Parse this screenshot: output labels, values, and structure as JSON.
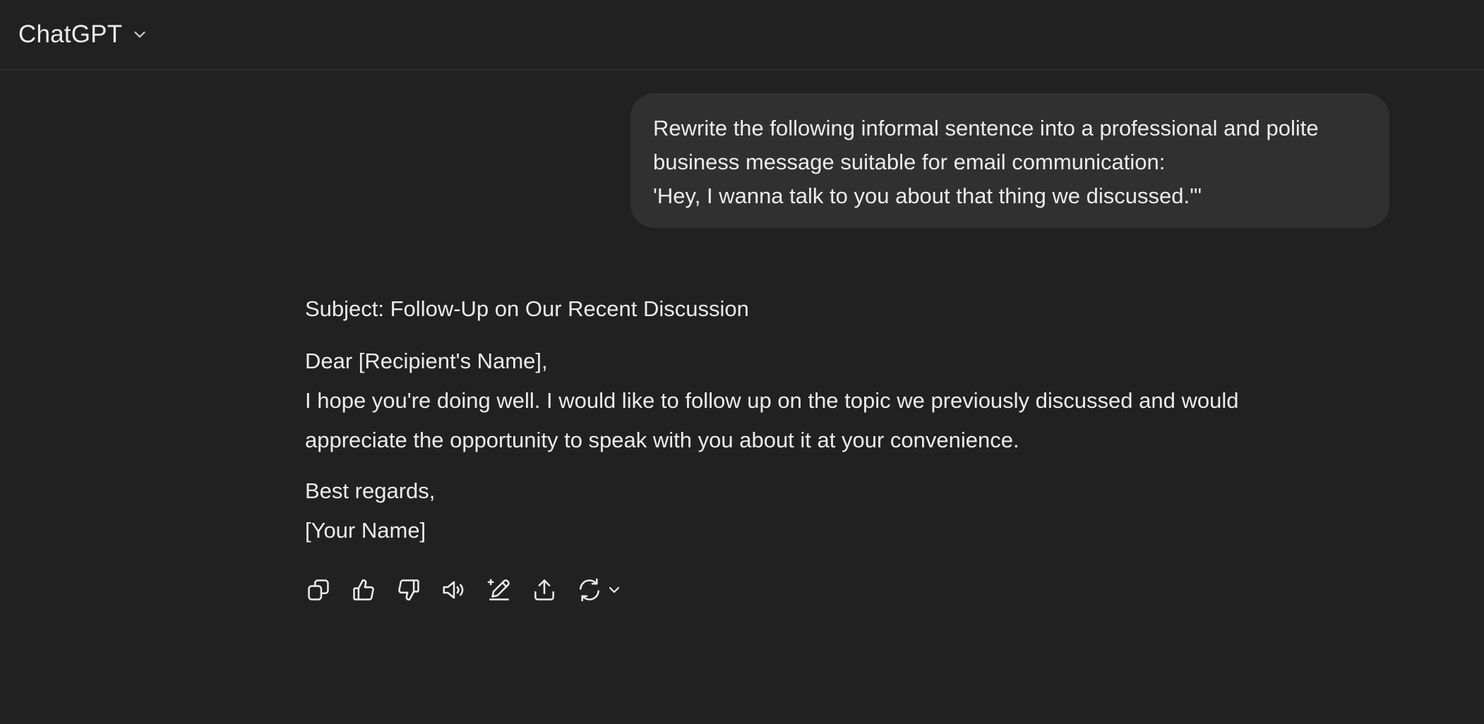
{
  "header": {
    "model_name": "ChatGPT",
    "model_switch_icon": "chevron-down-icon"
  },
  "user_message": {
    "lines": [
      "Rewrite the following informal sentence into a professional and polite",
      "business message suitable for email communication:",
      "'Hey, I wanna talk to you about that thing we discussed.'\""
    ]
  },
  "assistant_message": {
    "subject": "Subject: Follow-Up on Our Recent Discussion",
    "greeting": "Dear [Recipient's Name],",
    "body_lines": [
      "I hope you're doing well. I would like to follow up on the topic we previously discussed and would",
      "appreciate the opportunity to speak with you about it at your convenience."
    ],
    "closing": "Best regards,",
    "signature": "[Your Name]"
  },
  "actions": [
    {
      "name": "copy-icon"
    },
    {
      "name": "thumbs-up-icon"
    },
    {
      "name": "thumbs-down-icon"
    },
    {
      "name": "read-aloud-icon"
    },
    {
      "name": "edit-canvas-icon"
    },
    {
      "name": "share-icon"
    },
    {
      "name": "regenerate-icon"
    }
  ],
  "colors": {
    "background": "#212121",
    "bubble": "#303030",
    "text": "#ececec"
  }
}
